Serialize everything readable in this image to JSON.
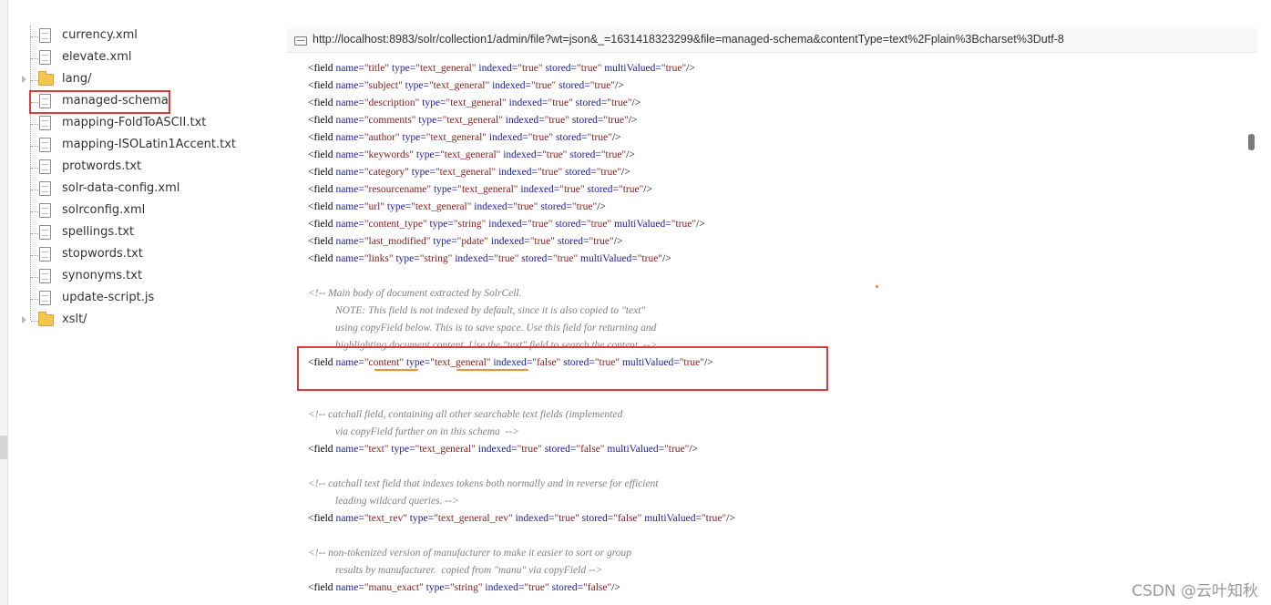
{
  "file_tree": {
    "items": [
      {
        "label": "currency.xml",
        "type": "file"
      },
      {
        "label": "elevate.xml",
        "type": "file"
      },
      {
        "label": "lang/",
        "type": "folder"
      },
      {
        "label": "managed-schema",
        "type": "file",
        "selected": true
      },
      {
        "label": "mapping-FoldToASCII.txt",
        "type": "file"
      },
      {
        "label": "mapping-ISOLatin1Accent.txt",
        "type": "file"
      },
      {
        "label": "protwords.txt",
        "type": "file"
      },
      {
        "label": "solr-data-config.xml",
        "type": "file"
      },
      {
        "label": "solrconfig.xml",
        "type": "file"
      },
      {
        "label": "spellings.txt",
        "type": "file"
      },
      {
        "label": "stopwords.txt",
        "type": "file"
      },
      {
        "label": "synonyms.txt",
        "type": "file"
      },
      {
        "label": "update-script.js",
        "type": "file"
      },
      {
        "label": "xslt/",
        "type": "folder"
      }
    ]
  },
  "url_bar": {
    "url": "http://localhost:8983/solr/collection1/admin/file?wt=json&_=1631418323299&file=managed-schema&contentType=text%2Fplain%3Bcharset%3Dutf-8"
  },
  "code_lines": [
    {
      "kind": "field",
      "attrs": [
        [
          "name",
          "title"
        ],
        [
          "type",
          "text_general"
        ],
        [
          "indexed",
          "true"
        ],
        [
          "stored",
          "true"
        ],
        [
          "multiValued",
          "true"
        ]
      ]
    },
    {
      "kind": "field",
      "attrs": [
        [
          "name",
          "subject"
        ],
        [
          "type",
          "text_general"
        ],
        [
          "indexed",
          "true"
        ],
        [
          "stored",
          "true"
        ]
      ]
    },
    {
      "kind": "field",
      "attrs": [
        [
          "name",
          "description"
        ],
        [
          "type",
          "text_general"
        ],
        [
          "indexed",
          "true"
        ],
        [
          "stored",
          "true"
        ]
      ]
    },
    {
      "kind": "field",
      "attrs": [
        [
          "name",
          "comments"
        ],
        [
          "type",
          "text_general"
        ],
        [
          "indexed",
          "true"
        ],
        [
          "stored",
          "true"
        ]
      ]
    },
    {
      "kind": "field",
      "attrs": [
        [
          "name",
          "author"
        ],
        [
          "type",
          "text_general"
        ],
        [
          "indexed",
          "true"
        ],
        [
          "stored",
          "true"
        ]
      ]
    },
    {
      "kind": "field",
      "attrs": [
        [
          "name",
          "keywords"
        ],
        [
          "type",
          "text_general"
        ],
        [
          "indexed",
          "true"
        ],
        [
          "stored",
          "true"
        ]
      ]
    },
    {
      "kind": "field",
      "attrs": [
        [
          "name",
          "category"
        ],
        [
          "type",
          "text_general"
        ],
        [
          "indexed",
          "true"
        ],
        [
          "stored",
          "true"
        ]
      ]
    },
    {
      "kind": "field",
      "attrs": [
        [
          "name",
          "resourcename"
        ],
        [
          "type",
          "text_general"
        ],
        [
          "indexed",
          "true"
        ],
        [
          "stored",
          "true"
        ]
      ]
    },
    {
      "kind": "field",
      "attrs": [
        [
          "name",
          "url"
        ],
        [
          "type",
          "text_general"
        ],
        [
          "indexed",
          "true"
        ],
        [
          "stored",
          "true"
        ]
      ]
    },
    {
      "kind": "field",
      "attrs": [
        [
          "name",
          "content_type"
        ],
        [
          "type",
          "string"
        ],
        [
          "indexed",
          "true"
        ],
        [
          "stored",
          "true"
        ],
        [
          "multiValued",
          "true"
        ]
      ]
    },
    {
      "kind": "field",
      "attrs": [
        [
          "name",
          "last_modified"
        ],
        [
          "type",
          "pdate"
        ],
        [
          "indexed",
          "true"
        ],
        [
          "stored",
          "true"
        ]
      ]
    },
    {
      "kind": "field",
      "attrs": [
        [
          "name",
          "links"
        ],
        [
          "type",
          "string"
        ],
        [
          "indexed",
          "true"
        ],
        [
          "stored",
          "true"
        ],
        [
          "multiValued",
          "true"
        ]
      ]
    },
    {
      "kind": "blank"
    },
    {
      "kind": "comment",
      "text": "<!-- Main body of document extracted by SolrCell."
    },
    {
      "kind": "comment",
      "indent": true,
      "text": "NOTE: This field is not indexed by default, since it is also copied to \"text\""
    },
    {
      "kind": "comment",
      "indent": true,
      "text": "using copyField below. This is to save space. Use this field for returning and"
    },
    {
      "kind": "comment",
      "indent": true,
      "text": "highlighting document content. Use the \"text\" field to search the content. -->"
    },
    {
      "kind": "field",
      "highlight": true,
      "attrs": [
        [
          "name",
          "content"
        ],
        [
          "type",
          "text_general"
        ],
        [
          "indexed",
          "false"
        ],
        [
          "stored",
          "true"
        ],
        [
          "multiValued",
          "true"
        ]
      ]
    },
    {
      "kind": "blank"
    },
    {
      "kind": "blank"
    },
    {
      "kind": "comment",
      "text": "<!-- catchall field, containing all other searchable text fields (implemented"
    },
    {
      "kind": "comment",
      "indent": true,
      "text": "via copyField further on in this schema  -->"
    },
    {
      "kind": "field",
      "attrs": [
        [
          "name",
          "text"
        ],
        [
          "type",
          "text_general"
        ],
        [
          "indexed",
          "true"
        ],
        [
          "stored",
          "false"
        ],
        [
          "multiValued",
          "true"
        ]
      ]
    },
    {
      "kind": "blank"
    },
    {
      "kind": "comment",
      "text": "<!-- catchall text field that indexes tokens both normally and in reverse for efficient"
    },
    {
      "kind": "comment",
      "indent": true,
      "text": "leading wildcard queries. -->"
    },
    {
      "kind": "field",
      "attrs": [
        [
          "name",
          "text_rev"
        ],
        [
          "type",
          "text_general_rev"
        ],
        [
          "indexed",
          "true"
        ],
        [
          "stored",
          "false"
        ],
        [
          "multiValued",
          "true"
        ]
      ]
    },
    {
      "kind": "blank"
    },
    {
      "kind": "comment",
      "text": "<!-- non-tokenized version of manufacturer to make it easier to sort or group"
    },
    {
      "kind": "comment",
      "indent": true,
      "text": "results by manufacturer.  copied from \"manu\" via copyField -->"
    },
    {
      "kind": "field",
      "attrs": [
        [
          "name",
          "manu_exact"
        ],
        [
          "type",
          "string"
        ],
        [
          "indexed",
          "true"
        ],
        [
          "stored",
          "false"
        ]
      ]
    }
  ],
  "watermark": "CSDN @云叶知秋",
  "colors": {
    "highlight_box": "#e0393e",
    "underline": "#f09030",
    "attr_name": "#1a1aa6",
    "attr_value": "#8b1a1a",
    "comment": "#808080"
  }
}
